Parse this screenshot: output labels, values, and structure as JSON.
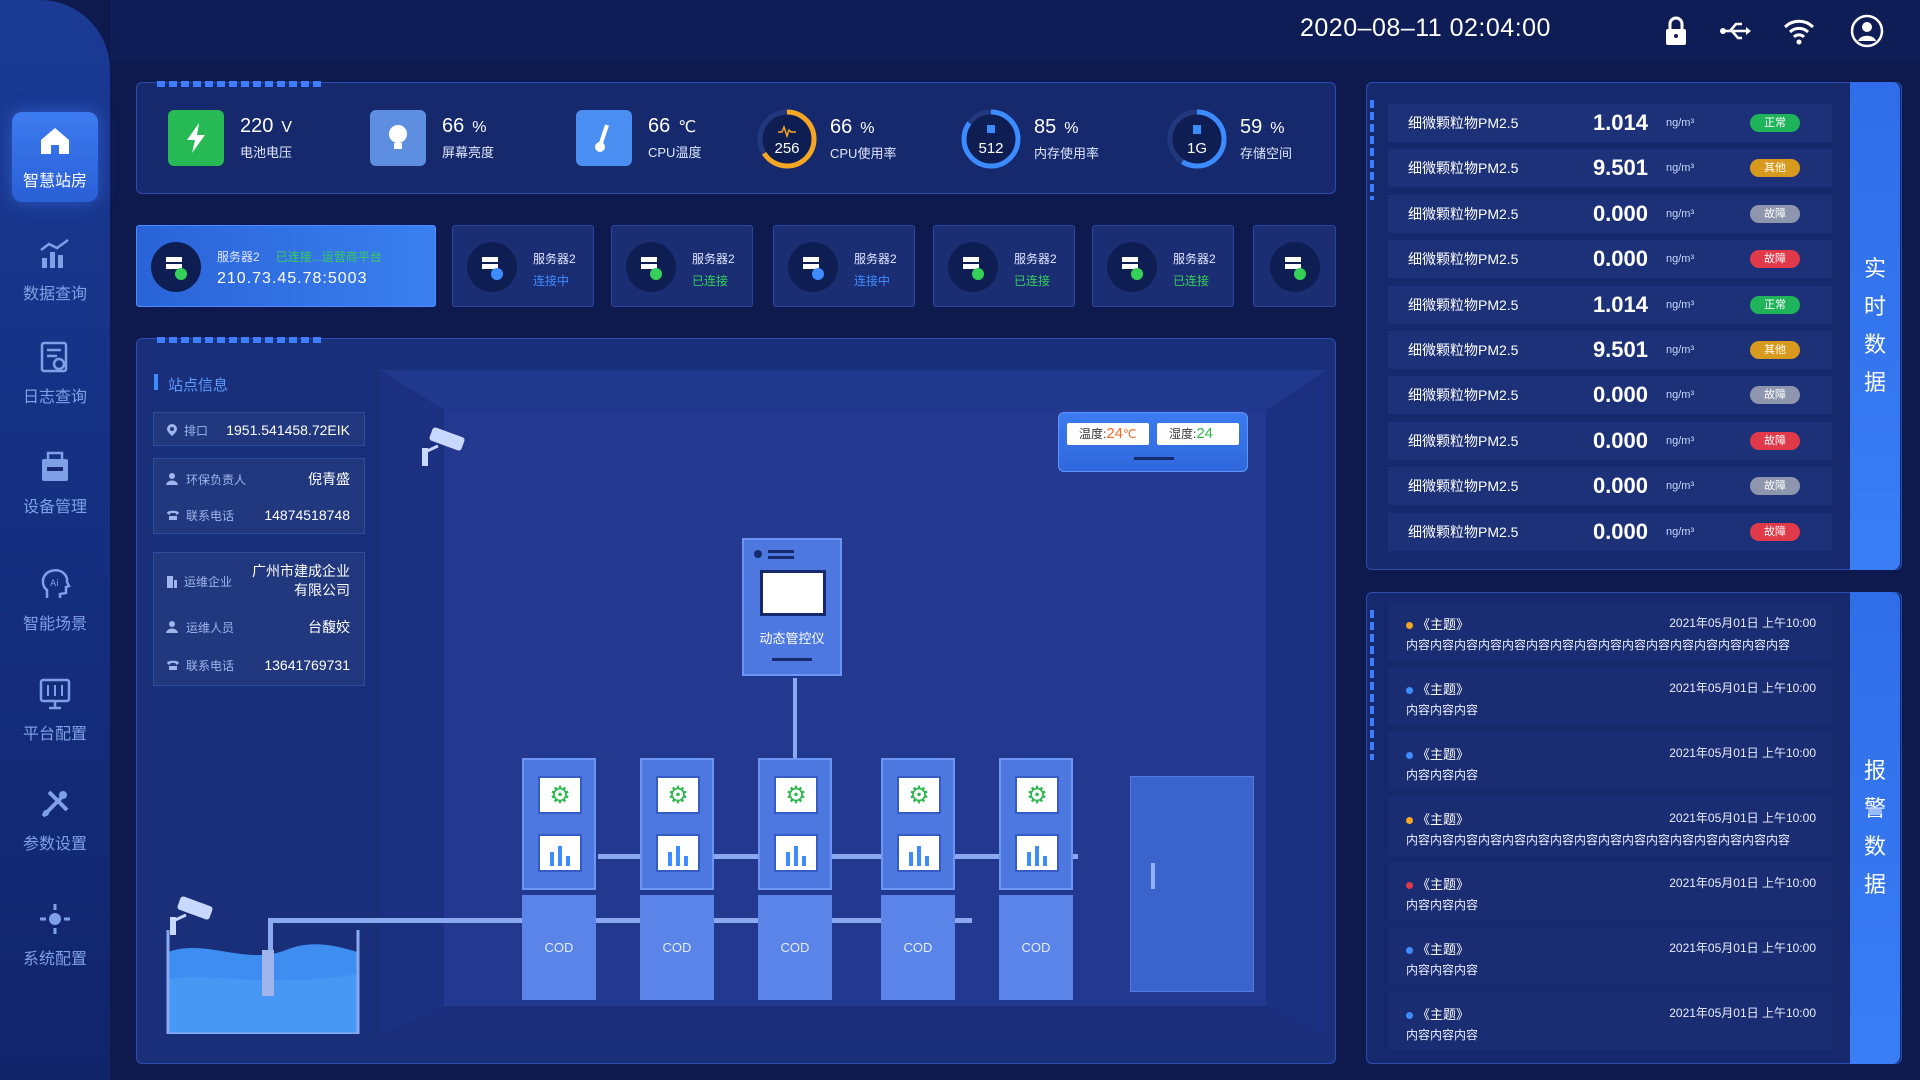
{
  "header": {
    "datetime": "2020–08–11  02:04:00",
    "icons": [
      "lock-icon",
      "usb-icon",
      "wifi-icon",
      "user-icon"
    ]
  },
  "sidebar": {
    "items": [
      {
        "label": "智慧站房",
        "icon": "home-icon",
        "active": true
      },
      {
        "label": "数据查询",
        "icon": "chart-icon"
      },
      {
        "label": "日志查询",
        "icon": "log-icon"
      },
      {
        "label": "设备管理",
        "icon": "device-icon"
      },
      {
        "label": "智能场景",
        "icon": "ai-icon"
      },
      {
        "label": "平台配置",
        "icon": "platform-icon"
      },
      {
        "label": "参数设置",
        "icon": "tools-icon"
      },
      {
        "label": "系统配置",
        "icon": "system-icon"
      }
    ]
  },
  "stats": [
    {
      "value": "220",
      "unit": "V",
      "label": "电池电压",
      "icon": "battery-icon"
    },
    {
      "value": "66",
      "unit": "%",
      "label": "屏幕亮度",
      "icon": "brightness-icon"
    },
    {
      "value": "66",
      "unit": "℃",
      "label": "CPU温度",
      "icon": "thermometer-icon"
    },
    {
      "value": "66",
      "unit": "%",
      "label": "CPU使用率",
      "ring": "256",
      "percent": 66,
      "ring_color": "#f5a623"
    },
    {
      "value": "85",
      "unit": "%",
      "label": "内存使用率",
      "ring": "512",
      "percent": 85,
      "ring_color": "#3c8cff"
    },
    {
      "value": "59",
      "unit": "%",
      "label": "存储空间",
      "ring": "1G",
      "percent": 59,
      "ring_color": "#3c8cff"
    }
  ],
  "servers": [
    {
      "name": "服务器2",
      "status": "已连接...运营商平台",
      "address": "210.73.45.78:5003",
      "active": true
    },
    {
      "name": "服务器2",
      "status": "连接中",
      "status_color": "#3f8cff"
    },
    {
      "name": "服务器2",
      "status": "已连接",
      "status_color": "#34d058"
    },
    {
      "name": "服务器2",
      "status": "连接中",
      "status_color": "#3f8cff"
    },
    {
      "name": "服务器2",
      "status": "已连接",
      "status_color": "#34d058"
    },
    {
      "name": "服务器2",
      "status": "已连接",
      "status_color": "#34d058"
    }
  ],
  "station": {
    "title": "站点信息",
    "outlet": {
      "key": "排口",
      "value": "1951.541458.72EIK"
    },
    "contact1": [
      {
        "key": "环保负责人",
        "value": "倪青盛"
      },
      {
        "key": "联系电话",
        "value": "14874518748"
      }
    ],
    "contact2": [
      {
        "key": "运维企业",
        "value": "广州市建成企业有限公司"
      },
      {
        "key": "运维人员",
        "value": "台馥姣"
      },
      {
        "key": "联系电话",
        "value": "13641769731"
      }
    ]
  },
  "scene": {
    "ac_temp_label": "温度:",
    "ac_temp_value": "24",
    "ac_temp_unit": "℃",
    "ac_hum_label": "湿度:",
    "ac_hum_value": "24",
    "controller_label": "动态管控仪",
    "cabinets": [
      "COD",
      "COD",
      "COD",
      "COD",
      "COD"
    ]
  },
  "realtime": {
    "tab_label": "实时数据",
    "rows": [
      {
        "name": "细微颗粒物PM2.5",
        "value": "1.014",
        "unit": "ng/m³",
        "status": "正常",
        "color": "#1fb35a"
      },
      {
        "name": "细微颗粒物PM2.5",
        "value": "9.501",
        "unit": "ng/m³",
        "status": "其他",
        "color": "#d89a1c"
      },
      {
        "name": "细微颗粒物PM2.5",
        "value": "0.000",
        "unit": "ng/m³",
        "status": "故障",
        "color": "#8d96ac"
      },
      {
        "name": "细微颗粒物PM2.5",
        "value": "0.000",
        "unit": "ng/m³",
        "status": "故障",
        "color": "#e0394a"
      },
      {
        "name": "细微颗粒物PM2.5",
        "value": "1.014",
        "unit": "ng/m³",
        "status": "正常",
        "color": "#1fb35a"
      },
      {
        "name": "细微颗粒物PM2.5",
        "value": "9.501",
        "unit": "ng/m³",
        "status": "其他",
        "color": "#d89a1c"
      },
      {
        "name": "细微颗粒物PM2.5",
        "value": "0.000",
        "unit": "ng/m³",
        "status": "故障",
        "color": "#8d96ac"
      },
      {
        "name": "细微颗粒物PM2.5",
        "value": "0.000",
        "unit": "ng/m³",
        "status": "故障",
        "color": "#e0394a"
      },
      {
        "name": "细微颗粒物PM2.5",
        "value": "0.000",
        "unit": "ng/m³",
        "status": "故障",
        "color": "#8d96ac"
      },
      {
        "name": "细微颗粒物PM2.5",
        "value": "0.000",
        "unit": "ng/m³",
        "status": "故障",
        "color": "#e0394a"
      }
    ]
  },
  "alarms": {
    "tab_label": "报警数据",
    "rows": [
      {
        "title": "《主题》",
        "date": "2021年05月01日  上午10:00",
        "content": "内容内容内容内容内容内容内容内容内容内容内容内容内容内容内容内容",
        "color": "#f5a623"
      },
      {
        "title": "《主题》",
        "date": "2021年05月01日  上午10:00",
        "content": "内容内容内容",
        "color": "#3f8cff"
      },
      {
        "title": "《主题》",
        "date": "2021年05月01日  上午10:00",
        "content": "内容内容内容",
        "color": "#3f8cff"
      },
      {
        "title": "《主题》",
        "date": "2021年05月01日  上午10:00",
        "content": "内容内容内容内容内容内容内容内容内容内容内容内容内容内容内容内容",
        "color": "#f5a623"
      },
      {
        "title": "《主题》",
        "date": "2021年05月01日  上午10:00",
        "content": "内容内容内容",
        "color": "#e0394a"
      },
      {
        "title": "《主题》",
        "date": "2021年05月01日  上午10:00",
        "content": "内容内容内容",
        "color": "#3f8cff"
      },
      {
        "title": "《主题》",
        "date": "2021年05月01日  上午10:00",
        "content": "内容内容内容",
        "color": "#3f8cff"
      }
    ]
  }
}
